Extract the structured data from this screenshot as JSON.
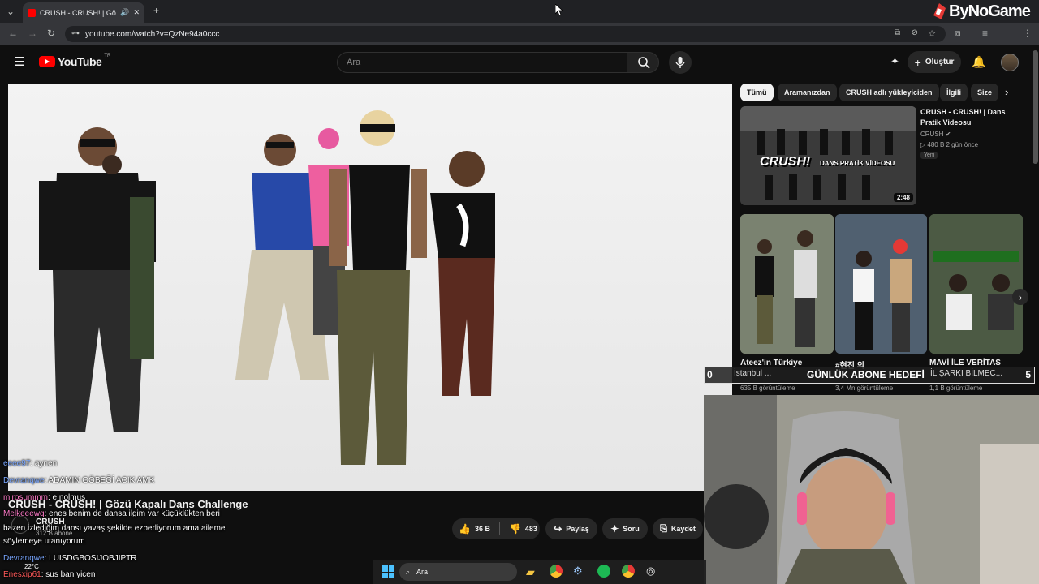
{
  "browser": {
    "tab_title": "CRUSH - CRUSH! | Gözü Ka",
    "url": "youtube.com/watch?v=QzNe94a0ccc",
    "new_tab": "+",
    "tab_close": "✕"
  },
  "watermark": {
    "text": "ByNoGame"
  },
  "youtube": {
    "logo": "YouTube",
    "logo_suffix": "TR",
    "search_placeholder": "Ara",
    "create_label": "Oluştur"
  },
  "chips": [
    "Tümü",
    "Aramanızdan",
    "CRUSH adlı yükleyiciden",
    "İlgili",
    "Size"
  ],
  "recommended": {
    "title_line1": "CRUSH - CRUSH! | Dans",
    "title_line2": "Pratik Videosu",
    "channel": "CRUSH",
    "stats": "480 B  2 gün önce",
    "badge": "Yeni",
    "duration": "2:48",
    "thumb_caption_big": "CRUSH!",
    "thumb_caption_small": "DANS PRATİK VİDEOSU"
  },
  "shorts": [
    {
      "title": "Ateez'in Türkiye",
      "sub": "İstanbul ...",
      "views": "635 B görüntüleme"
    },
    {
      "title": "#현진 의",
      "sub": "",
      "views": "3,4 Mn görüntüleme"
    },
    {
      "title": "MAVİ İLE VERİTAS",
      "sub": "İL ŞARKI BİLMEC...",
      "views": "1,1 B görüntüleme"
    }
  ],
  "video": {
    "title": "CRUSH - CRUSH! | Gözü Kapalı Dans Challenge",
    "channel": "CRUSH",
    "subs": "312 B abone",
    "likes": "36 B",
    "dislikes": "483",
    "share": "Paylaş",
    "ask": "Soru",
    "save": "Kaydet"
  },
  "chat": [
    {
      "user": "eeee97",
      "msg": ": aynen"
    },
    {
      "user": "Devranqwe",
      "msg": ": ADAMIN GÖBEĞİ ACIK AMK"
    },
    {
      "user": "mirosummm",
      "msg": ": e nolmus"
    },
    {
      "user": "Melkeeewq",
      "msg": ": enes benim de dansa ilgim var küçüklükten beri"
    },
    {
      "user": "",
      "msg": "bazen izlediğim dansı yavaş şekilde ezberliyorum ama aileme"
    },
    {
      "user": "",
      "msg": "söylemeye utanıyorum"
    },
    {
      "user": "Devranqwe",
      "msg": ": LUISDGBOSIJOBJIPTR"
    },
    {
      "user": "Enesxip61",
      "msg": ": sus ban yicen"
    }
  ],
  "goal": {
    "label": "GÜNLÜK ABONE HEDEFİ",
    "current": "0",
    "target": "5"
  },
  "taskbar": {
    "search": "Ara",
    "weather": "22°C"
  },
  "colors": {
    "accent_red": "#ff0000",
    "chat_user_blue": "#7aa7ff",
    "chat_user_pink": "#ff7ac8"
  }
}
